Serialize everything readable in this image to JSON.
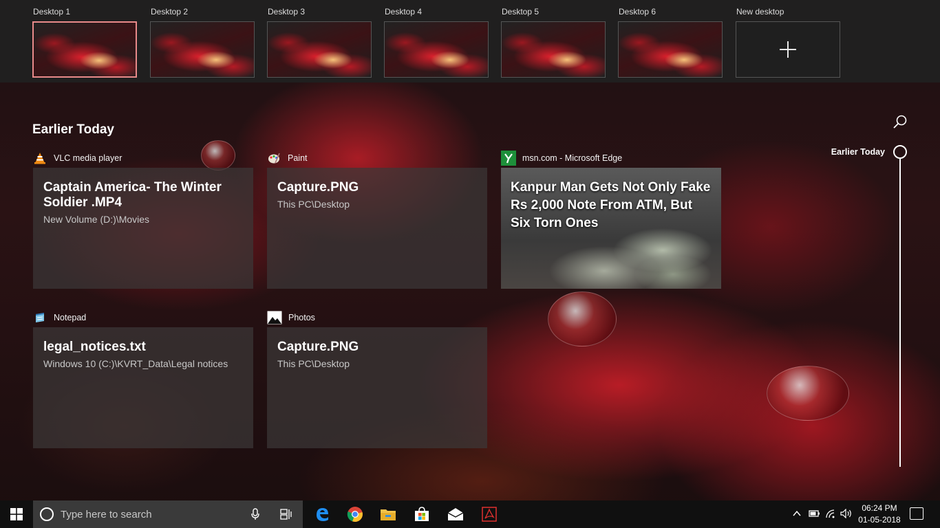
{
  "desktops": [
    {
      "label": "Desktop 1",
      "active": true
    },
    {
      "label": "Desktop 2",
      "active": false
    },
    {
      "label": "Desktop 3",
      "active": false
    },
    {
      "label": "Desktop 4",
      "active": false
    },
    {
      "label": "Desktop 5",
      "active": false
    },
    {
      "label": "Desktop 6",
      "active": false
    }
  ],
  "new_desktop": {
    "label": "New desktop",
    "icon": "plus-icon"
  },
  "timeline": {
    "section_title": "Earlier Today",
    "scrubber_label": "Earlier Today",
    "search_icon": "search-icon",
    "activities": [
      {
        "app": "VLC media player",
        "icon": "vlc-icon",
        "title": "Captain America- The Winter Soldier .MP4",
        "subtitle": "New Volume (D:)\\Movies"
      },
      {
        "app": "Paint",
        "icon": "paint-icon",
        "title": "Capture.PNG",
        "subtitle": "This PC\\Desktop"
      },
      {
        "app": "msn.com - Microsoft Edge",
        "icon": "edge-site-icon",
        "title": "Kanpur Man Gets Not Only Fake Rs 2,000 Note From ATM, But Six Torn Ones",
        "subtitle": ""
      },
      {
        "app": "Notepad",
        "icon": "notepad-icon",
        "title": "legal_notices.txt",
        "subtitle": "Windows 10 (C:)\\KVRT_Data\\Legal notices"
      },
      {
        "app": "Photos",
        "icon": "photos-icon",
        "title": "Capture.PNG",
        "subtitle": "This PC\\Desktop"
      }
    ]
  },
  "taskbar": {
    "search_placeholder": "Type here to search",
    "pinned": [
      "edge-icon",
      "chrome-icon",
      "file-explorer-icon",
      "store-icon",
      "mail-icon",
      "pdf-icon"
    ],
    "time": "06:24 PM",
    "date": "01-05-2018"
  },
  "colors": {
    "active_desktop_border": "#e98a8a",
    "taskbar_bg": "#101010",
    "search_bg": "#3a3a3a"
  }
}
